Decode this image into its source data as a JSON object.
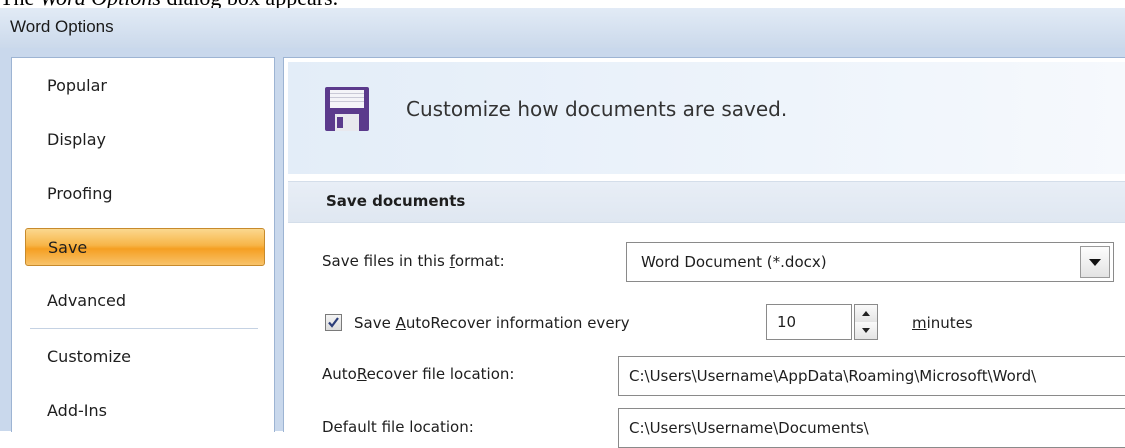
{
  "caption": {
    "prefix": "The ",
    "emphasis": "Word Options",
    "suffix": " dialog box appears."
  },
  "window": {
    "title": "Word Options"
  },
  "nav": {
    "items": [
      {
        "label": "Popular"
      },
      {
        "label": "Display"
      },
      {
        "label": "Proofing"
      },
      {
        "label": "Save",
        "selected": true
      },
      {
        "label": "Advanced"
      },
      {
        "label": "Customize"
      },
      {
        "label": "Add-Ins"
      }
    ]
  },
  "header": {
    "icon": "floppy-disk-icon",
    "text": "Customize how documents are saved."
  },
  "section": {
    "title": "Save documents"
  },
  "format": {
    "label_pre": "Save files in this ",
    "label_key": "f",
    "label_post": "ormat:",
    "value": "Word Document (*.docx)"
  },
  "autorecover": {
    "checked": true,
    "label_pre": "Save ",
    "label_key": "A",
    "label_post": "utoRecover information every",
    "value": "10",
    "unit_key": "m",
    "unit_post": "inutes"
  },
  "autorecover_location": {
    "label_pre": "Auto",
    "label_key": "R",
    "label_post": "ecover file location:",
    "value": "C:\\Users\\Username\\AppData\\Roaming\\Microsoft\\Word\\"
  },
  "default_location": {
    "label_pre": "Default f",
    "label_key": "i",
    "label_post": "le location:",
    "value": "C:\\Users\\Username\\Documents\\"
  },
  "colors": {
    "selected_nav": "#f7b548",
    "window_frame": "#c9d8ec",
    "icon_purple": "#5b3a8c"
  }
}
